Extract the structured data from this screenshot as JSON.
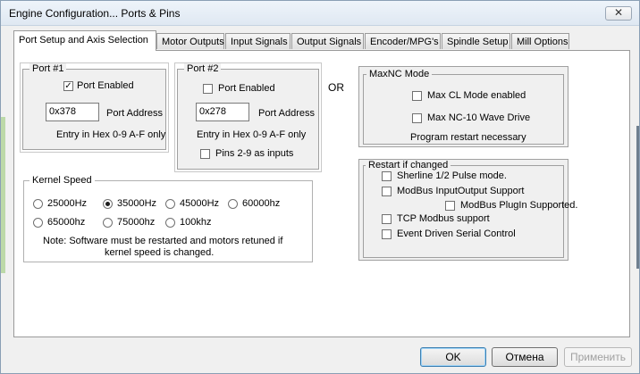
{
  "window": {
    "title": "Engine Configuration... Ports & Pins",
    "close_glyph": "✕"
  },
  "tabs": [
    {
      "label": "Port Setup and Axis Selection"
    },
    {
      "label": "Motor Outputs"
    },
    {
      "label": "Input Signals"
    },
    {
      "label": "Output Signals"
    },
    {
      "label": "Encoder/MPG's"
    },
    {
      "label": "Spindle Setup"
    },
    {
      "label": "Mill Options"
    }
  ],
  "port1": {
    "legend": "Port #1",
    "enabled_label": "Port Enabled",
    "enabled_checked": true,
    "address_value": "0x378",
    "address_label": "Port Address",
    "hint": "Entry in Hex 0-9 A-F only"
  },
  "port2": {
    "legend": "Port #2",
    "enabled_label": "Port Enabled",
    "enabled_checked": false,
    "address_value": "0x278",
    "address_label": "Port Address",
    "hint": "Entry in Hex 0-9 A-F only",
    "pins_label": "Pins 2-9 as inputs",
    "pins_checked": false
  },
  "or_label": "OR",
  "maxnc": {
    "legend": "MaxNC Mode",
    "cl_label": "Max CL Mode enabled",
    "wave_label": "Max NC-10 Wave Drive",
    "note": "Program restart necessary"
  },
  "kernel": {
    "legend": "Kernel Speed",
    "options": [
      "25000Hz",
      "35000Hz",
      "45000Hz",
      "60000hz",
      "65000hz",
      "75000hz",
      "100khz"
    ],
    "selected": "35000Hz",
    "note_line1": "Note: Software must be restarted and motors retuned if",
    "note_line2": "kernel speed is changed."
  },
  "restart": {
    "legend": "Restart if changed",
    "sherline": "Sherline 1/2 Pulse mode.",
    "modbus_io": "ModBus InputOutput Support",
    "modbus_plugin": "ModBus PlugIn Supported.",
    "tcp_modbus": "TCP Modbus support",
    "event_serial": "Event Driven Serial Control"
  },
  "buttons": {
    "ok": "OK",
    "cancel": "Отмена",
    "apply": "Применить"
  }
}
